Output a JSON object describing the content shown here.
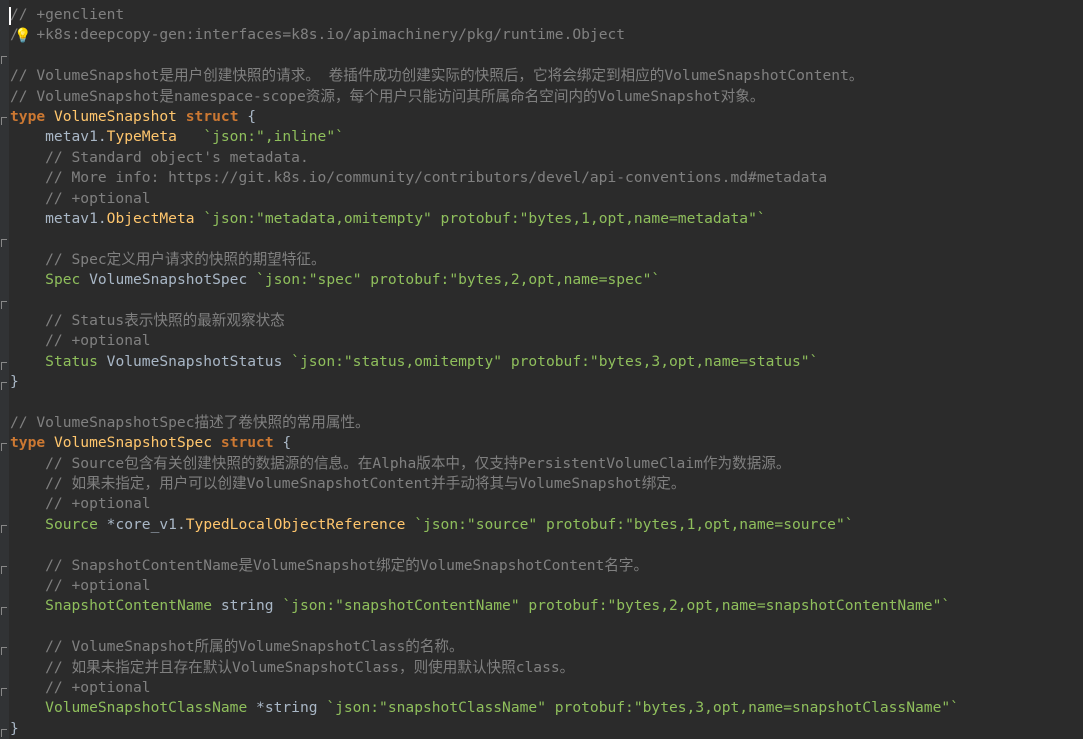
{
  "editor": {
    "lines": [
      [
        [
          "comment",
          "// +genclient"
        ]
      ],
      [
        [
          "comment",
          "/"
        ],
        [
          "plain",
          "  "
        ],
        [
          "comment",
          "+k8s:deepcopy-gen:interfaces=k8s.io/apimachinery/pkg/runtime.Object"
        ]
      ],
      [
        [
          "plain",
          ""
        ]
      ],
      [
        [
          "comment",
          "// VolumeSnapshot是用户创建快照的请求。 卷插件成功创建实际的快照后，它将会绑定到相应的VolumeSnapshotContent。"
        ]
      ],
      [
        [
          "comment",
          "// VolumeSnapshot是namespace-scope资源，每个用户只能访问其所属命名空间内的VolumeSnapshot对象。"
        ]
      ],
      [
        [
          "kw",
          "type"
        ],
        [
          "plain",
          " "
        ],
        [
          "name",
          "VolumeSnapshot"
        ],
        [
          "plain",
          " "
        ],
        [
          "kw",
          "struct"
        ],
        [
          "plain",
          " {"
        ]
      ],
      [
        [
          "plain",
          "    metav1."
        ],
        [
          "name",
          "TypeMeta"
        ],
        [
          "plain",
          "   "
        ],
        [
          "tagstr",
          "`json:\",inline\"`"
        ]
      ],
      [
        [
          "comment",
          "    // Standard object's metadata."
        ]
      ],
      [
        [
          "comment",
          "    // More info: https://git.k8s.io/community/contributors/devel/api-conventions.md#metadata"
        ]
      ],
      [
        [
          "comment",
          "    // +optional"
        ]
      ],
      [
        [
          "plain",
          "    metav1."
        ],
        [
          "name",
          "ObjectMeta"
        ],
        [
          "plain",
          " "
        ],
        [
          "tagstr",
          "`json:\"metadata,omitempty\" protobuf:\"bytes,1,opt,name=metadata\"`"
        ]
      ],
      [
        [
          "plain",
          ""
        ]
      ],
      [
        [
          "comment",
          "    // Spec定义用户请求的快照的期望特征。"
        ]
      ],
      [
        [
          "plain",
          "    "
        ],
        [
          "fieldname",
          "Spec"
        ],
        [
          "plain",
          " VolumeSnapshotSpec "
        ],
        [
          "tagstr",
          "`json:\"spec\" protobuf:\"bytes,2,opt,name=spec\"`"
        ]
      ],
      [
        [
          "plain",
          ""
        ]
      ],
      [
        [
          "comment",
          "    // Status表示快照的最新观察状态"
        ]
      ],
      [
        [
          "comment",
          "    // +optional"
        ]
      ],
      [
        [
          "plain",
          "    "
        ],
        [
          "fieldname",
          "Status"
        ],
        [
          "plain",
          " VolumeSnapshotStatus "
        ],
        [
          "tagstr",
          "`json:\"status,omitempty\" protobuf:\"bytes,3,opt,name=status\"`"
        ]
      ],
      [
        [
          "plain",
          "}"
        ]
      ],
      [
        [
          "plain",
          ""
        ]
      ],
      [
        [
          "comment",
          "// VolumeSnapshotSpec描述了卷快照的常用属性。"
        ]
      ],
      [
        [
          "kw",
          "type"
        ],
        [
          "plain",
          " "
        ],
        [
          "name",
          "VolumeSnapshotSpec"
        ],
        [
          "plain",
          " "
        ],
        [
          "kw",
          "struct"
        ],
        [
          "plain",
          " {"
        ]
      ],
      [
        [
          "comment",
          "    // Source包含有关创建快照的数据源的信息。在Alpha版本中，仅支持PersistentVolumeClaim作为数据源。"
        ]
      ],
      [
        [
          "comment",
          "    // 如果未指定，用户可以创建VolumeSnapshotContent并手动将其与VolumeSnapshot绑定。"
        ]
      ],
      [
        [
          "comment",
          "    // +optional"
        ]
      ],
      [
        [
          "plain",
          "    "
        ],
        [
          "fieldname",
          "Source"
        ],
        [
          "plain",
          " *core_v1."
        ],
        [
          "name",
          "TypedLocalObjectReference"
        ],
        [
          "plain",
          " "
        ],
        [
          "tagstr",
          "`json:\"source\" protobuf:\"bytes,1,opt,name=source\"`"
        ]
      ],
      [
        [
          "plain",
          ""
        ]
      ],
      [
        [
          "comment",
          "    // SnapshotContentName是VolumeSnapshot绑定的VolumeSnapshotContent名字。"
        ]
      ],
      [
        [
          "comment",
          "    // +optional"
        ]
      ],
      [
        [
          "plain",
          "    "
        ],
        [
          "fieldname",
          "SnapshotContentName"
        ],
        [
          "plain",
          " string "
        ],
        [
          "tagstr",
          "`json:\"snapshotContentName\" protobuf:\"bytes,2,opt,name=snapshotContentName\"`"
        ]
      ],
      [
        [
          "plain",
          ""
        ]
      ],
      [
        [
          "comment",
          "    // VolumeSnapshot所属的VolumeSnapshotClass的名称。"
        ]
      ],
      [
        [
          "comment",
          "    // 如果未指定并且存在默认VolumeSnapshotClass，则使用默认快照class。"
        ]
      ],
      [
        [
          "comment",
          "    // +optional"
        ]
      ],
      [
        [
          "plain",
          "    "
        ],
        [
          "fieldname",
          "VolumeSnapshotClassName"
        ],
        [
          "plain",
          " *string "
        ],
        [
          "tagstr",
          "`json:\"snapshotClassName\" protobuf:\"bytes,3,opt,name=snapshotClassName\"`"
        ]
      ],
      [
        [
          "plain",
          "}"
        ]
      ]
    ],
    "icons": {
      "bulb": "lightbulb-icon",
      "fold": "fold-marker-icon"
    },
    "colors": {
      "background": "#2b2b2b",
      "comment": "#808080",
      "keyword": "#cc7832",
      "type_name": "#ffc66d",
      "field_name": "#8fbf5c",
      "tag_string": "#8fbf5c",
      "plain": "#a9b7c6"
    }
  }
}
